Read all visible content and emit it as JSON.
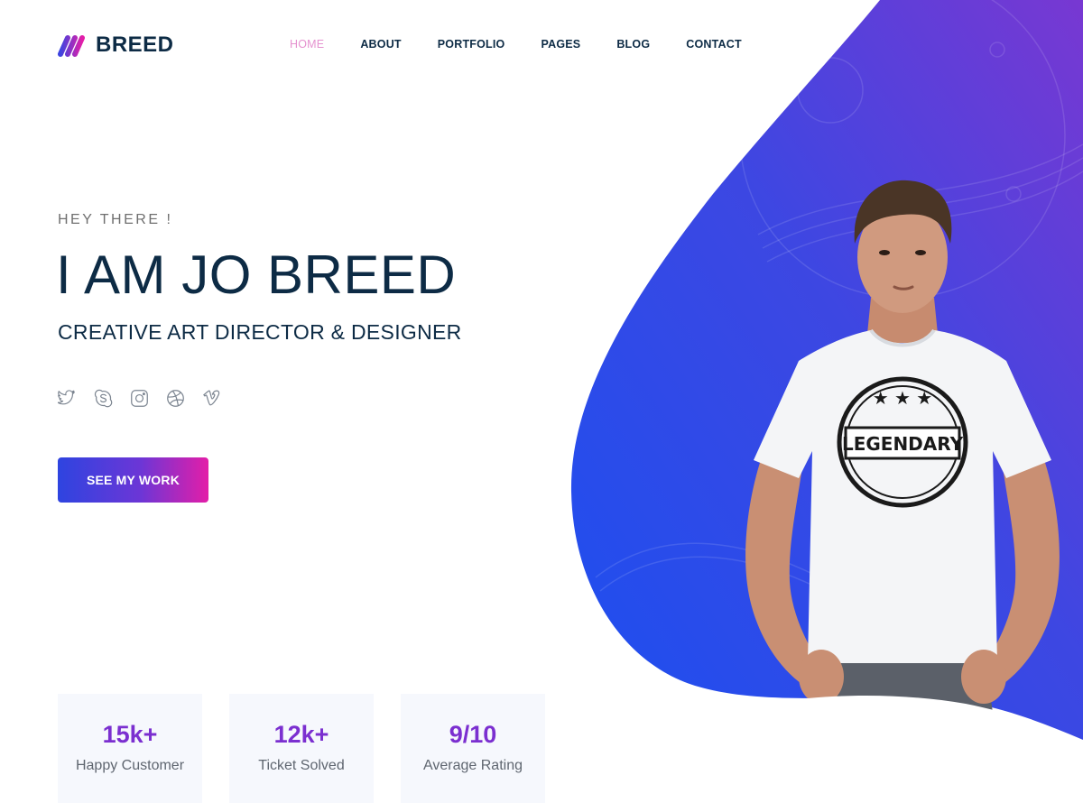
{
  "brand": {
    "name": "BREED"
  },
  "nav": {
    "items": [
      {
        "label": "HOME",
        "active": true
      },
      {
        "label": "ABOUT",
        "active": false
      },
      {
        "label": "PORTFOLIO",
        "active": false
      },
      {
        "label": "PAGES",
        "active": false
      },
      {
        "label": "BLOG",
        "active": false
      },
      {
        "label": "CONTACT",
        "active": false
      }
    ]
  },
  "hero": {
    "eyebrow": "HEY THERE !",
    "title": "I AM JO BREED",
    "subtitle": "CREATIVE ART DIRECTOR & DESIGNER",
    "cta_label": "SEE MY WORK",
    "shirt_text": "LEGENDARY"
  },
  "socials": [
    "twitter-icon",
    "skype-icon",
    "instagram-icon",
    "dribbble-icon",
    "vimeo-icon"
  ],
  "stats": [
    {
      "value": "15k+",
      "label": "Happy Customer"
    },
    {
      "value": "12k+",
      "label": "Ticket Solved"
    },
    {
      "value": "9/10",
      "label": "Average Rating"
    }
  ],
  "colors": {
    "primary_text": "#0d2b45",
    "nav_active": "#e592cf",
    "gradient_start": "#2e44e0",
    "gradient_end": "#e31ea8",
    "stat_value": "#7b2fd0",
    "blob_blue": "#1d4fe6",
    "blob_purple": "#7a39d4"
  }
}
